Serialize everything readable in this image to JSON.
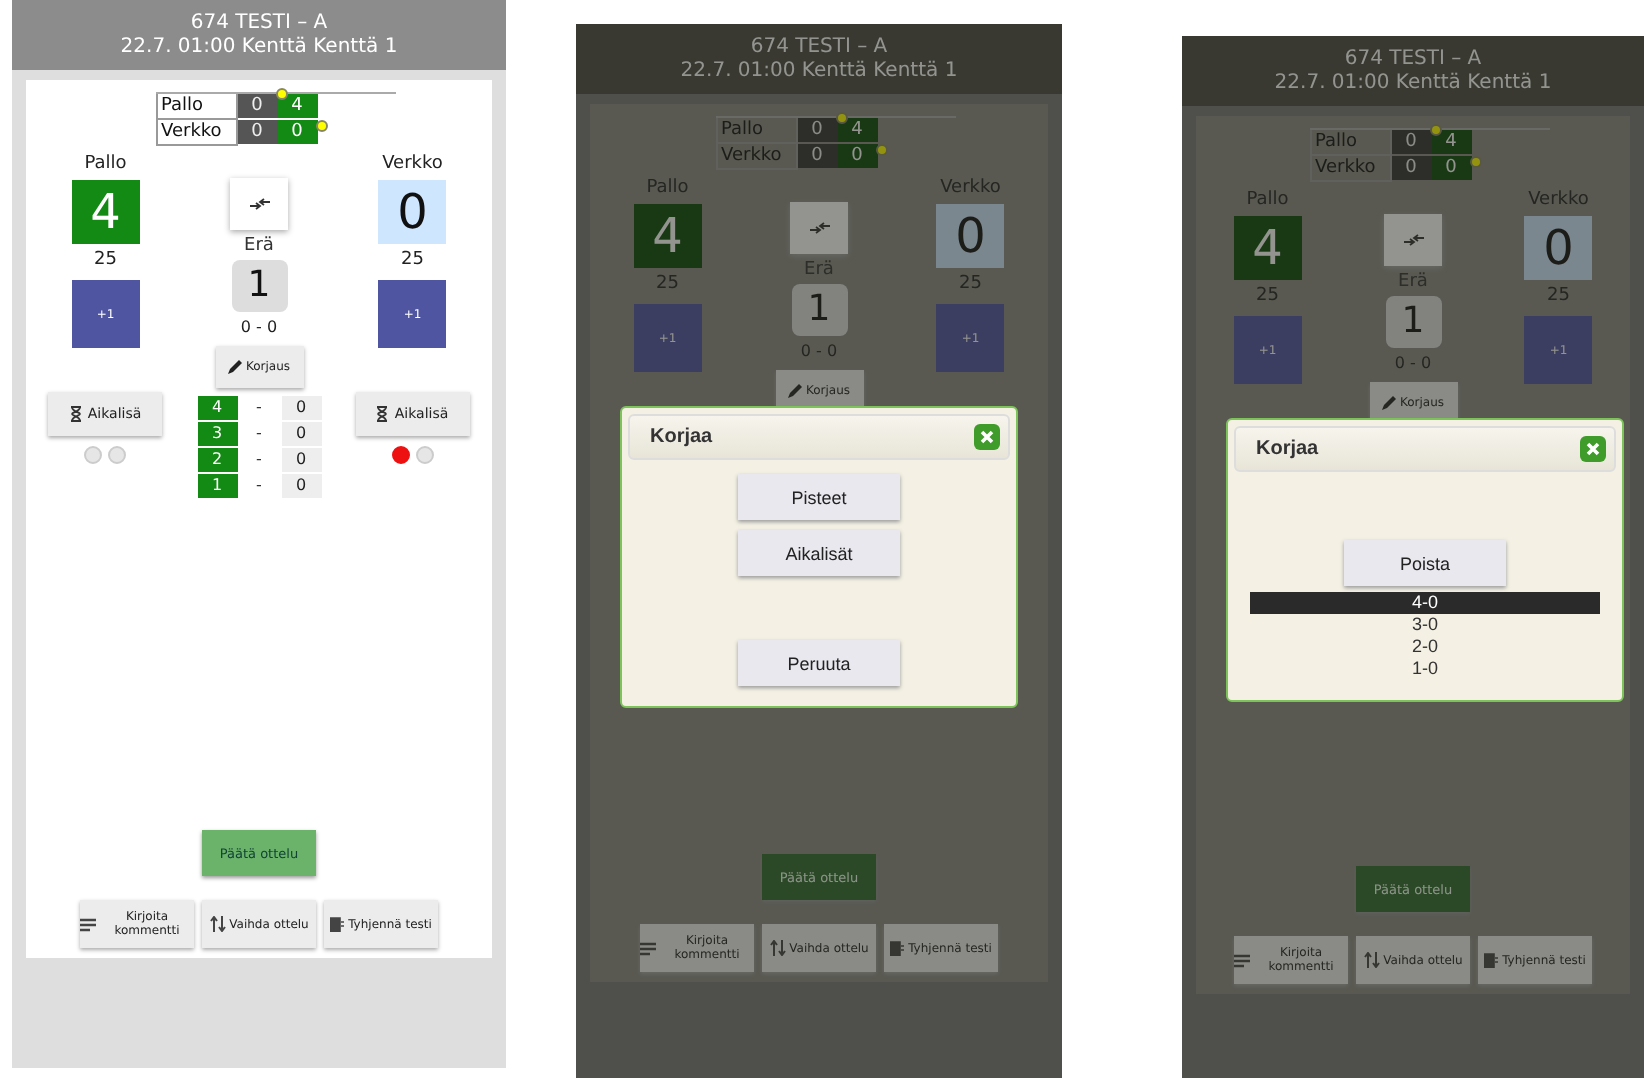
{
  "screens": [
    {
      "header": {
        "title": "674 TESTI – A",
        "subtitle": "22.7. 01:00 Kenttä Kenttä 1"
      },
      "mini_table": [
        {
          "team": "Pallo",
          "sets": "0",
          "points": "4"
        },
        {
          "team": "Verkko",
          "sets": "0",
          "points": "0"
        }
      ],
      "teams": [
        {
          "name": "Pallo",
          "score": "4",
          "serving": true,
          "target": "25",
          "add": "+1"
        },
        {
          "name": "Verkko",
          "score": "0",
          "serving": false,
          "target": "25",
          "add": "+1"
        }
      ],
      "set_label": "Erä",
      "set_number": "1",
      "set_score": "0 - 0",
      "correction": "Korjaus",
      "timeouts": [
        {
          "label": "Aikalisä",
          "dots": [
            {
              "on": false
            },
            {
              "on": false
            }
          ]
        },
        {
          "label": "Aikalisä",
          "dots": [
            {
              "on": true
            },
            {
              "on": false
            }
          ]
        }
      ],
      "set_points": [
        {
          "number": "4",
          "separator": "-",
          "value": "0"
        },
        {
          "number": "3",
          "separator": "-",
          "value": "0"
        },
        {
          "number": "2",
          "separator": "-",
          "value": "0"
        },
        {
          "number": "1",
          "separator": "-",
          "value": "0"
        }
      ],
      "end_match": "Päätä ottelu",
      "actions": [
        {
          "kind": "comment",
          "label": "Kirjoita kommentti"
        },
        {
          "kind": "switch",
          "label": "Vaihda ottelu"
        },
        {
          "kind": "clear",
          "label": "Tyhjennä testi"
        }
      ]
    },
    {
      "header": {
        "title": "674 TESTI – A",
        "subtitle": "22.7. 01:00 Kenttä Kenttä 1"
      },
      "mini_table": [
        {
          "team": "Pallo",
          "sets": "0",
          "points": "4"
        },
        {
          "team": "Verkko",
          "sets": "0",
          "points": "0"
        }
      ],
      "teams": [
        {
          "name": "Pallo",
          "score": "4",
          "serving": true,
          "target": "25",
          "add": "+1"
        },
        {
          "name": "Verkko",
          "score": "0",
          "serving": false,
          "target": "25",
          "add": "+1"
        }
      ],
      "set_label": "Erä",
      "set_number": "1",
      "set_score": "0 - 0",
      "correction": "Korjaus",
      "end_match": "Päätä ottelu",
      "actions": [
        {
          "kind": "comment",
          "label": "Kirjoita kommentti"
        },
        {
          "kind": "switch",
          "label": "Vaihda ottelu"
        },
        {
          "kind": "clear",
          "label": "Tyhjennä testi"
        }
      ],
      "dialog": {
        "title": "Korjaa",
        "kind": "menu",
        "buttons": [
          "Pisteet",
          "Aikalisät",
          "Peruuta"
        ]
      }
    },
    {
      "header": {
        "title": "674 TESTI – A",
        "subtitle": "22.7. 01:00 Kenttä Kenttä 1"
      },
      "mini_table": [
        {
          "team": "Pallo",
          "sets": "0",
          "points": "4"
        },
        {
          "team": "Verkko",
          "sets": "0",
          "points": "0"
        }
      ],
      "teams": [
        {
          "name": "Pallo",
          "score": "4",
          "serving": true,
          "target": "25",
          "add": "+1"
        },
        {
          "name": "Verkko",
          "score": "0",
          "serving": false,
          "target": "25",
          "add": "+1"
        }
      ],
      "set_label": "Erä",
      "set_number": "1",
      "set_score": "0 - 0",
      "correction": "Korjaus",
      "end_match": "Päätä ottelu",
      "actions": [
        {
          "kind": "comment",
          "label": "Kirjoita kommentti"
        },
        {
          "kind": "switch",
          "label": "Vaihda ottelu"
        },
        {
          "kind": "clear",
          "label": "Tyhjennä testi"
        }
      ],
      "dialog": {
        "title": "Korjaa",
        "kind": "list",
        "buttons": [
          "Poista"
        ],
        "items": [
          {
            "label": "4-0",
            "selected": true
          },
          {
            "label": "3-0",
            "selected": false
          },
          {
            "label": "2-0",
            "selected": false
          },
          {
            "label": "1-0",
            "selected": false
          }
        ]
      }
    }
  ]
}
